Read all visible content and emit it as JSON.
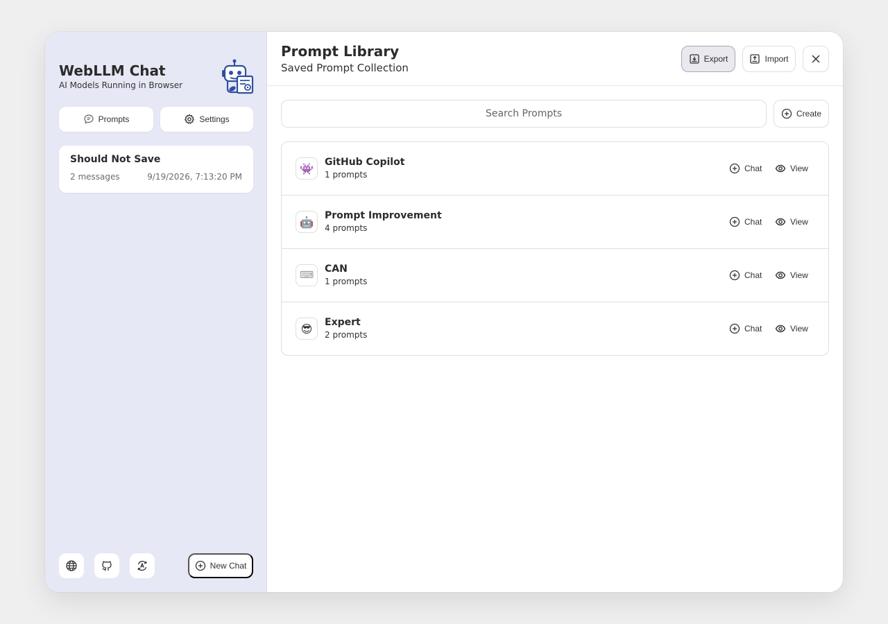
{
  "sidebar": {
    "title": "WebLLM Chat",
    "subtitle": "AI Models Running in Browser",
    "logo_icon": "robot-logo-icon",
    "buttons": {
      "prompts": "Prompts",
      "settings": "Settings"
    },
    "chats": [
      {
        "title": "Should Not Save",
        "count": "2 messages",
        "date": "9/19/2026, 7:13:20 PM"
      }
    ],
    "footer": {
      "new_chat": "New Chat",
      "icons": [
        "globe-icon",
        "github-icon",
        "translate-icon"
      ]
    }
  },
  "header": {
    "title": "Prompt Library",
    "subtitle": "Saved Prompt Collection",
    "export_label": "Export",
    "import_label": "Import"
  },
  "search": {
    "placeholder": "Search Prompts",
    "value": ""
  },
  "create_label": "Create",
  "prompt_groups": [
    {
      "emoji": "👾",
      "name": "GitHub Copilot",
      "count": "1 prompts",
      "chat": "Chat",
      "view": "View"
    },
    {
      "emoji": "🤖",
      "name": "Prompt Improvement",
      "count": "4 prompts",
      "chat": "Chat",
      "view": "View"
    },
    {
      "emoji": "⌨",
      "name": "CAN",
      "count": "1 prompts",
      "chat": "Chat",
      "view": "View"
    },
    {
      "emoji": "😎",
      "name": "Expert",
      "count": "2 prompts",
      "chat": "Chat",
      "view": "View"
    }
  ],
  "colors": {
    "sidebar_bg": "#e7e8f5",
    "accent": "#2f4fa0",
    "page_bg": "#efefef"
  }
}
